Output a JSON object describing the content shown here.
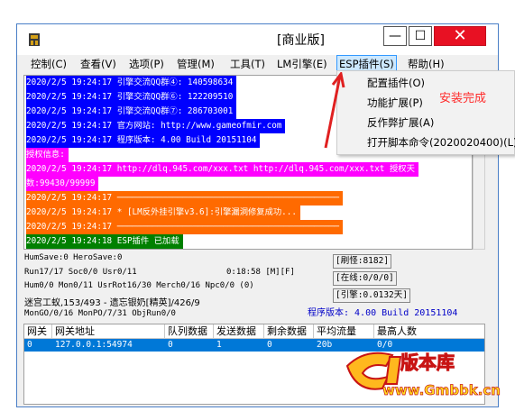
{
  "window": {
    "title": "[商业版]",
    "minimize_glyph": "—",
    "maximize_glyph": "☐",
    "close_glyph": "✕"
  },
  "menu": {
    "items": [
      "控制(C)",
      "查看(V)",
      "选项(P)",
      "管理(M)",
      "工具(T)",
      "LM引擎(E)",
      "ESP插件(S)",
      "帮助(H)"
    ],
    "active_index": 6
  },
  "log": {
    "lines": [
      {
        "text": "2020/2/5 19:24:17 引擎交流QQ群④: 140598634",
        "bg": "#0000ff",
        "fg": "#ffffff"
      },
      {
        "text": "2020/2/5 19:24:17 引擎交流QQ群⑥: 122209510",
        "bg": "#0000ff",
        "fg": "#ffffff"
      },
      {
        "text": "2020/2/5 19:24:17 引擎交流QQ群⑦: 286703001",
        "bg": "#0000ff",
        "fg": "#ffffff"
      },
      {
        "text": "2020/2/5 19:24:17 官方网站: http://www.gameofmir.com",
        "bg": "#0000ff",
        "fg": "#ffffff"
      },
      {
        "text": "2020/2/5 19:24:17 程序版本: 4.00 Build 20151104",
        "bg": "#0000ff",
        "fg": "#ffffff"
      },
      {
        "text": "授权信息:",
        "bg": "#ff00ff",
        "fg": "#ffffff"
      },
      {
        "text": "2020/2/5 19:24:17 http://dlq.945.com/xxx.txt http://dlq.945.com/xxx.txt 授权天",
        "bg": "#ff00ff",
        "fg": "#ffffff"
      },
      {
        "text": "数:99430/99999",
        "bg": "#ff00ff",
        "fg": "#ffffff"
      },
      {
        "text": "2020/2/5 19:24:17 ────────────────────────────────────────────",
        "bg": "#ff6a00",
        "fg": "#ffffff"
      },
      {
        "text": "2020/2/5 19:24:17 * [LM反外挂引擎v3.6]:引擎漏洞修复成功...",
        "bg": "#ff6a00",
        "fg": "#ffffff"
      },
      {
        "text": "2020/2/5 19:24:17 ────────────────────────────────────────────",
        "bg": "#ff6a00",
        "fg": "#ffffff"
      },
      {
        "text": "2020/2/5 19:24:18 ESP插件 已加载",
        "bg": "#008000",
        "fg": "#ffffff"
      }
    ]
  },
  "status": {
    "line1": "HumSave:0 HeroSave:0",
    "line2_left": "Run17/17 Soc0/0 Usr0/11",
    "line2_time": "0:18:58 [M][F]",
    "line3": "Hum0/0 Mon0/11 UsrRot16/30 Merch0/16 Npc0/0 (0)",
    "line4": "迷宫工蚁,153/493 - 遗忘银奶[精英]/426/9",
    "line5": "MonGO/0/16 MonPO/7/31 ObjRun0/0",
    "version": "程序版本: 4.00 Build 20151104",
    "refresh": "[刷怪:8182]",
    "online": "[在线:0/0/0]",
    "engine": "[引擎:0.0132天]"
  },
  "table": {
    "headers": [
      "网关",
      "网关地址",
      "队列数据",
      "发送数据",
      "剩余数据",
      "平均流量",
      "最高人数"
    ],
    "rows": [
      [
        "0",
        "127.0.0.1:54974",
        "0",
        "1",
        "0",
        "20b",
        "0/0"
      ]
    ]
  },
  "dropdown": {
    "items": [
      "配置插件(O)",
      "功能扩展(P)",
      "反作弊扩展(A)",
      "打开脚本命令(2020020400)(L)"
    ]
  },
  "annotation": {
    "text": "安装完成",
    "color": "#ff2a2a"
  },
  "watermark": {
    "brand": "版本库",
    "url": "www.Gmbbk.cn"
  },
  "colors": {
    "menu_active_border": "#3399ff",
    "menu_active_bg": "#cce8ff",
    "selection": "#0078d7",
    "close_button": "#e81123"
  },
  "icons": {
    "app": "app-logo-icon",
    "arrow": "red-arrow-icon"
  }
}
